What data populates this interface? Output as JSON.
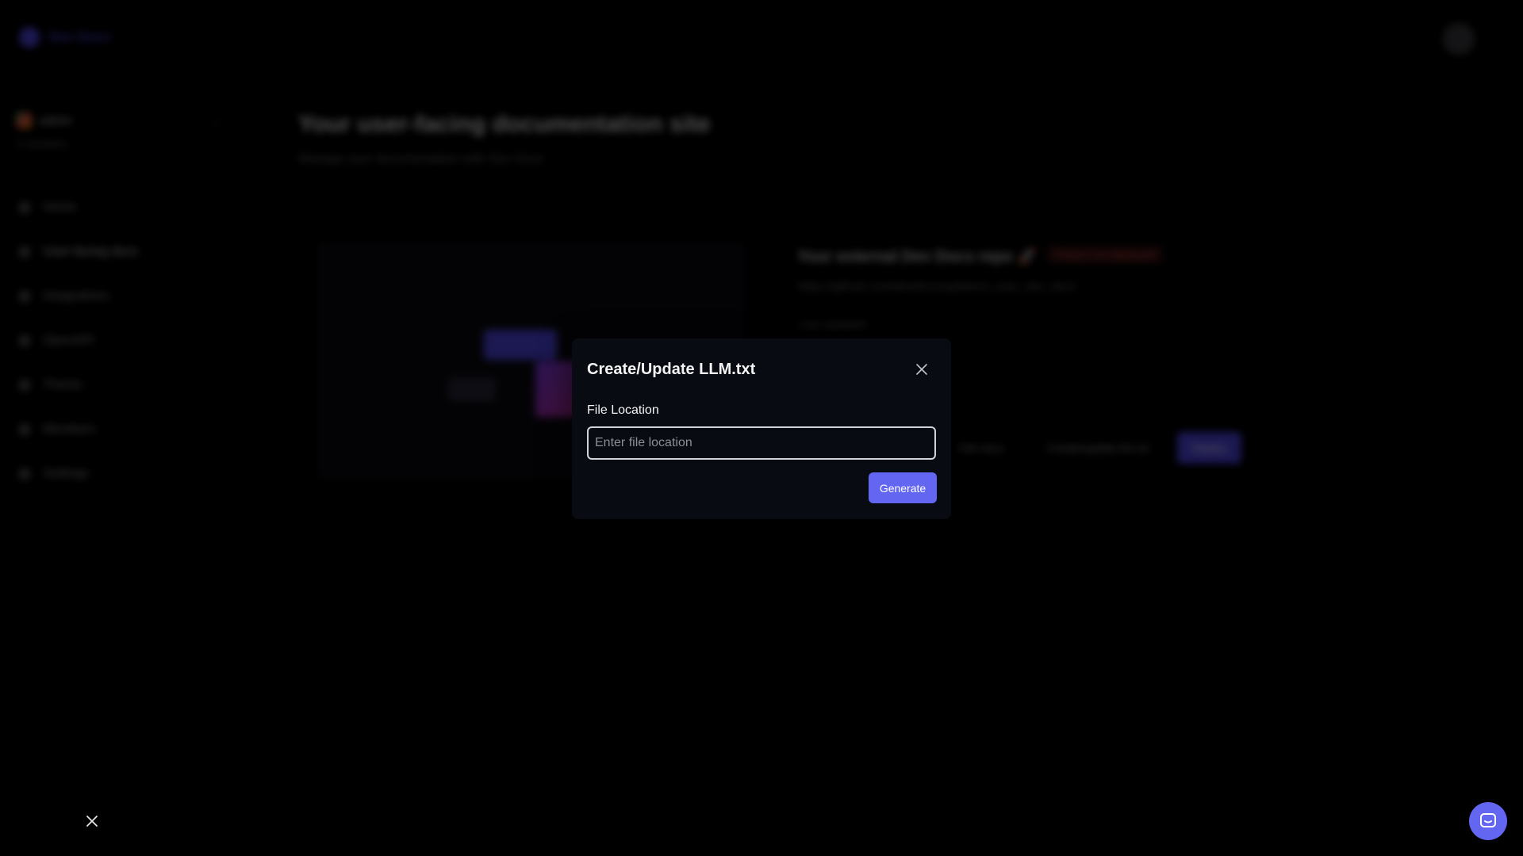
{
  "app": {
    "brand_name": "Dev Docs",
    "org_name": "admin",
    "org_count": "0 members"
  },
  "sidebar": {
    "items": [
      {
        "label": "Home",
        "icon": "home-icon"
      },
      {
        "label": "User-facing docs",
        "icon": "book-icon"
      },
      {
        "label": "Integrations",
        "icon": "plug-icon"
      },
      {
        "label": "OpenAPI",
        "icon": "code-icon"
      },
      {
        "label": "Theme",
        "icon": "palette-icon"
      },
      {
        "label": "Members",
        "icon": "users-icon"
      },
      {
        "label": "Settings",
        "icon": "gear-icon"
      }
    ]
  },
  "main": {
    "title": "Your user-facing documentation site",
    "subtitle": "Manage your documentation with Dev Docs"
  },
  "repo_card": {
    "title": "Your external Dev Docs repo 🚀",
    "badge": "Project not deployed",
    "url": "https://github.com/devdocsorg/demo_user_dev_docs",
    "last_updated": "Last updated:",
    "actions": [
      "Edit docs",
      "Create/update llm.txt",
      "Deploy"
    ]
  },
  "modal": {
    "title": "Create/Update LLM.txt",
    "field_label": "File Location",
    "input_placeholder": "Enter file location",
    "input_value": "",
    "submit_label": "Generate"
  },
  "colors": {
    "accent": "#6366f1",
    "modal_bg": "#080b12",
    "background": "#000000"
  }
}
